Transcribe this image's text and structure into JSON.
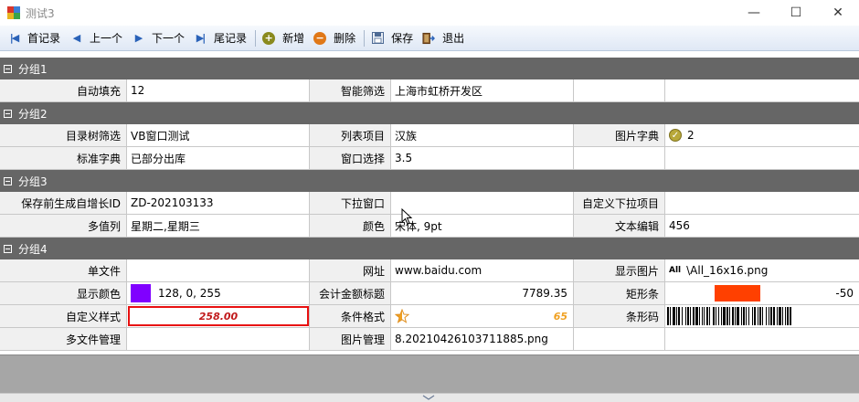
{
  "window": {
    "title": "测试3",
    "minimize": "—",
    "maximize": "☐",
    "close": "✕"
  },
  "toolbar": [
    {
      "label": "首记录",
      "icon": "first-record-icon"
    },
    {
      "label": "上一个",
      "icon": "previous-icon"
    },
    {
      "label": "下一个",
      "icon": "next-icon"
    },
    {
      "label": "尾记录",
      "icon": "last-record-icon"
    },
    {
      "label": "新增",
      "icon": "add-icon"
    },
    {
      "label": "删除",
      "icon": "delete-icon"
    },
    {
      "label": "保存",
      "icon": "save-icon"
    },
    {
      "label": "退出",
      "icon": "exit-icon"
    }
  ],
  "groups": [
    {
      "title": "分组1",
      "rows": [
        {
          "l1": "自动填充",
          "v1": "12",
          "l2": "智能筛选",
          "v2": "上海市虹桥开发区",
          "l3": "",
          "v3": ""
        }
      ]
    },
    {
      "title": "分组2",
      "rows": [
        {
          "l1": "目录树筛选",
          "v1": "VB窗口测试",
          "l2": "列表项目",
          "v2": "汉族",
          "l3": "图片字典",
          "v3": "2"
        },
        {
          "l1": "标准字典",
          "v1": "已部分出库",
          "l2": "窗口选择",
          "v2": "3.5",
          "l3": "",
          "v3": ""
        }
      ]
    },
    {
      "title": "分组3",
      "rows": [
        {
          "l1": "保存前生成自增长ID",
          "v1": "ZD-202103133",
          "l2": "下拉窗口",
          "v2": "",
          "l3": "自定义下拉项目",
          "v3": ""
        },
        {
          "l1": "多值列",
          "v1": "星期二,星期三",
          "l2": "颜色",
          "v2": "宋体, 9pt",
          "l3": "文本编辑",
          "v3": "456"
        }
      ]
    },
    {
      "title": "分组4",
      "rows": [
        {
          "l1": "单文件",
          "v1": "",
          "l2": "网址",
          "v2": "www.baidu.com",
          "l3": "显示图片",
          "v3": "\\All_16x16.png",
          "v3_icon_text": "All"
        },
        {
          "l1": "显示颜色",
          "v1": "128, 0, 255",
          "l2": "会计金额标题",
          "v2": "7789.35",
          "l3": "矩形条",
          "v3": "-50"
        },
        {
          "l1": "自定义样式",
          "v1": "258.00",
          "l2": "条件格式",
          "v2": "65",
          "l3": "条形码",
          "v3": ""
        },
        {
          "l1": "多文件管理",
          "v1": "",
          "l2": "图片管理",
          "v2": "8.20210426103711885.png",
          "l3": "",
          "v3": ""
        }
      ]
    }
  ],
  "colors": {
    "swatch": "#8000ff",
    "bar": "#ff4000",
    "style_border": "#e81010",
    "group_header": "#666666"
  },
  "rect_bar_fraction": 0.5
}
